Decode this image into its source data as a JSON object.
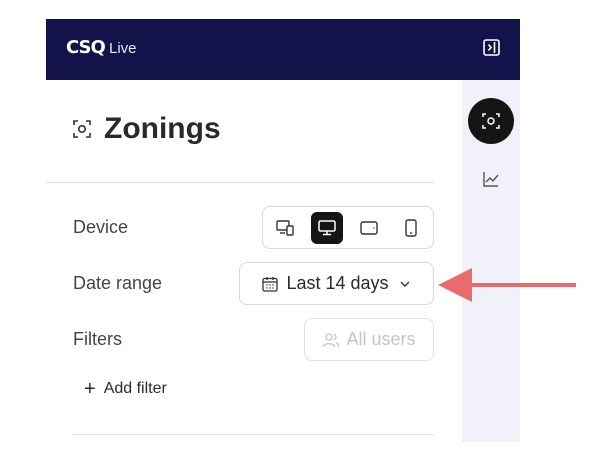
{
  "header": {
    "logo_text": "CSQ",
    "logo_suffix": "Live"
  },
  "page": {
    "title": "Zonings"
  },
  "controls": {
    "device_label": "Device",
    "date_range_label": "Date range",
    "date_range_value": "Last 14 days",
    "filters_label": "Filters",
    "filters_value": "All users",
    "add_filter_label": "Add filter",
    "device_options": [
      "multi-device",
      "desktop",
      "tablet",
      "mobile"
    ],
    "device_selected": "desktop"
  },
  "colors": {
    "header_bg": "#14124a",
    "rail_bg": "#f1f1fa",
    "active_dark": "#151515",
    "arrow": "#e86c6c"
  },
  "icons": {
    "title": "zoning-icon",
    "rail": [
      "zoning-icon",
      "line-chart-icon"
    ],
    "header_right": "collapse-panel-icon"
  }
}
